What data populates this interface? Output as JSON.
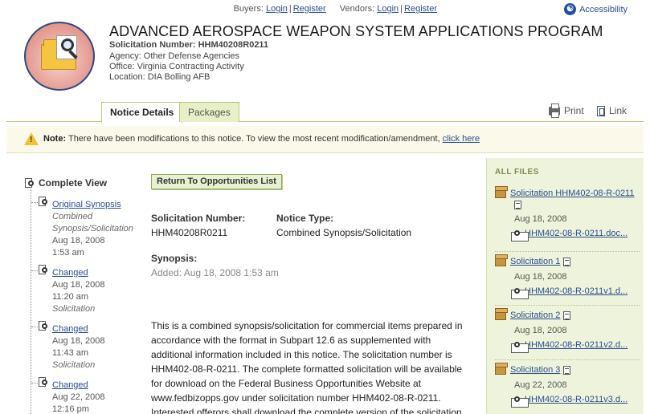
{
  "utility": {
    "buyers_label": "Buyers:",
    "buyers_login": "Login",
    "buyers_register": "Register",
    "vendors_label": "Vendors:",
    "vendors_login": "Login",
    "vendors_register": "Register",
    "accessibility": "Accessibility"
  },
  "header": {
    "title": "ADVANCED AEROSPACE WEAPON SYSTEM APPLICATIONS PROGRAM",
    "solicitation": "Solicitation Number: HHM40208R0211",
    "agency": "Agency: Other Defense Agencies",
    "office": "Office: Virginia Contracting Activity",
    "location": "Location: DIA Bolling AFB"
  },
  "tabs": {
    "notice_details": "Notice Details",
    "packages": "Packages",
    "print": "Print",
    "link": "Link"
  },
  "note": {
    "label": "Note:",
    "text": "There have been modifications to this notice. To view the most recent modification/amendment,",
    "link": "click here"
  },
  "timeline": {
    "complete_view": "Complete View",
    "items": [
      {
        "link": "Original Synopsis",
        "lines": [
          "Combined",
          "Synopsis/Solicitation"
        ],
        "date": "Aug 18, 2008",
        "time": "1:53 am"
      },
      {
        "link": "Changed",
        "date": "Aug 18, 2008",
        "time": "11:20 am",
        "type": "Solicitation"
      },
      {
        "link": "Changed",
        "date": "Aug 18, 2008",
        "time": "11:43 am",
        "type": "Solicitation"
      },
      {
        "link": "Changed",
        "date": "Aug 22, 2008",
        "time": "12:16 pm"
      }
    ]
  },
  "main": {
    "return_button": "Return To Opportunities List",
    "sol_number_label": "Solicitation Number:",
    "sol_number_value": "HHM40208R0211",
    "notice_type_label": "Notice Type:",
    "notice_type_value": "Combined Synopsis/Solicitation",
    "synopsis_label": "Synopsis:",
    "synopsis_added": "Added: Aug 18, 2008 1:53 am",
    "paragraph": "This is a combined synopsis/solicitation for commercial items prepared in accordance with the format in Subpart 12.6 as supplemented with additional information included in this notice. The solicitation number is HHM402-08-R-0211. The complete formatted solicitation will be available for download on the Federal Business Opportunities Website at www.fedbizopps.gov under solicitation number HHM402-08-R-0211. Interested offerors shall download the complete version of the solicitation from the aforementioned website"
  },
  "files": {
    "title": "ALL FILES",
    "items": [
      {
        "name": "Solicitation HHM402-08-R-0211",
        "date": "Aug 18, 2008",
        "doc": "HHM402-08-R-0211.doc..."
      },
      {
        "name": "Solicitation 1",
        "date": "Aug 18, 2008",
        "doc": "HHM402-08-R-0211v1.d..."
      },
      {
        "name": "Solicitation 2",
        "date": "Aug 18, 2008",
        "doc": "HHM402-08-R-0211v2.d..."
      },
      {
        "name": "Solicitation 3",
        "date": "Aug 22, 2008",
        "doc": "HHM402-08-R-0211v3.d..."
      }
    ]
  }
}
